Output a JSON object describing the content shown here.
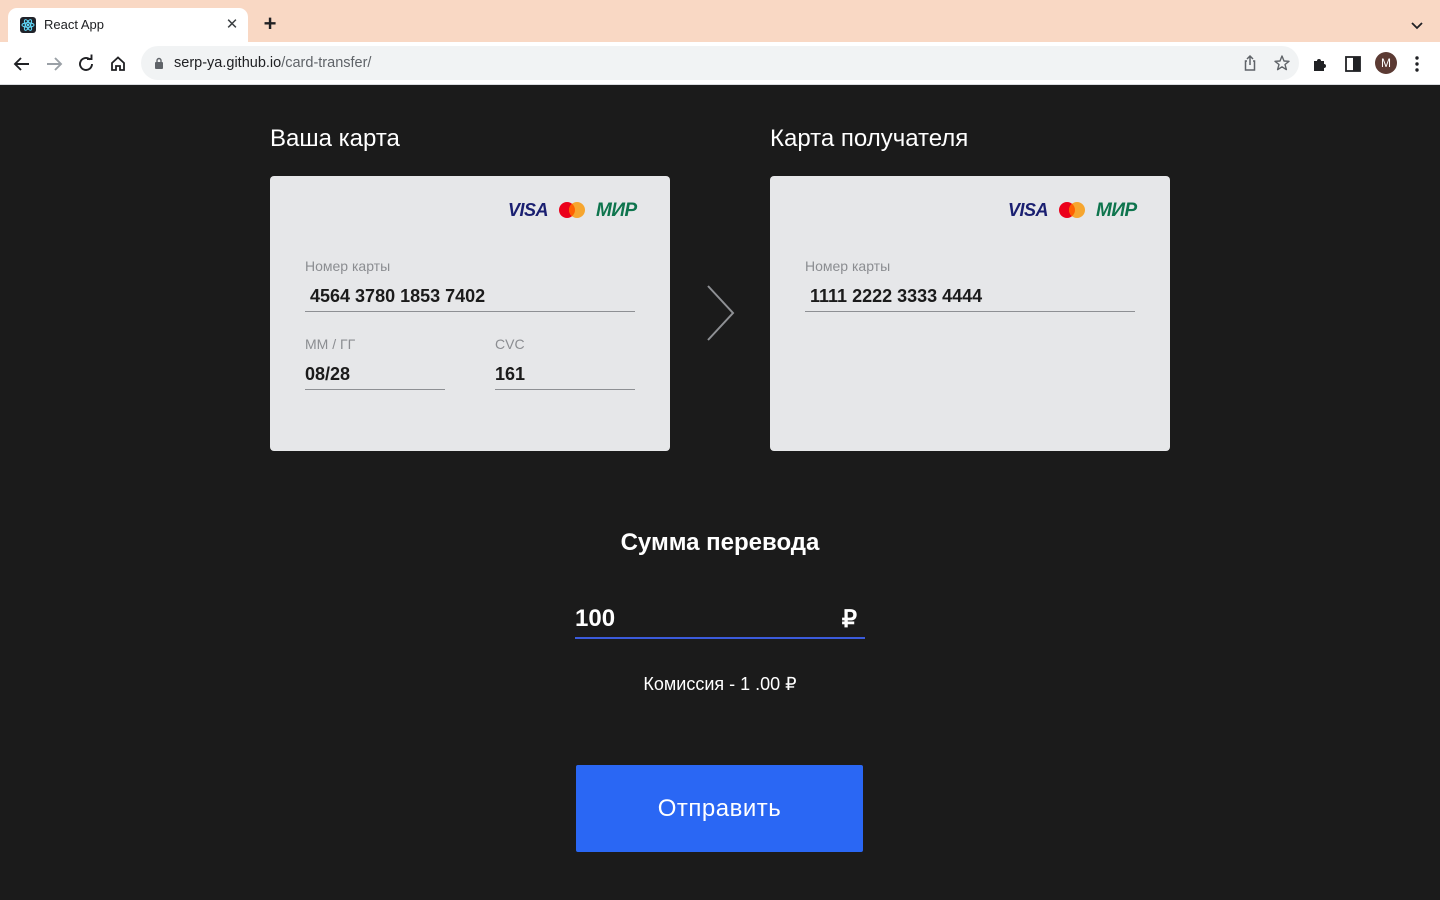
{
  "browser": {
    "tab_title": "React App",
    "tab_close": "✕",
    "new_tab": "+",
    "url_host": "serp-ya.github.io",
    "url_path": "/card-transfer/",
    "avatar_letter": "M"
  },
  "sender_card": {
    "title": "Ваша карта",
    "brands": {
      "visa": "VISA",
      "mir": "МИР"
    },
    "number_label": "Номер карты",
    "number_value": "4564 3780 1853 7402",
    "expiry_label": "ММ / ГГ",
    "expiry_value": "08/28",
    "cvc_label": "CVC",
    "cvc_value": "161"
  },
  "recipient_card": {
    "title": "Карта получателя",
    "brands": {
      "visa": "VISA",
      "mir": "МИР"
    },
    "number_label": "Номер карты",
    "number_value": "1111 2222 3333 4444"
  },
  "transfer": {
    "title": "Сумма перевода",
    "amount": "100",
    "currency": "₽",
    "commission": "Комиссия - 1 .00 ₽",
    "submit_label": "Отправить"
  },
  "colors": {
    "page_bg": "#1b1b1b",
    "card_bg": "#e6e7e9",
    "accent": "#2a67f4",
    "input_underline": "#3b5bdb",
    "tabbar_bg": "#f9d8c4"
  }
}
